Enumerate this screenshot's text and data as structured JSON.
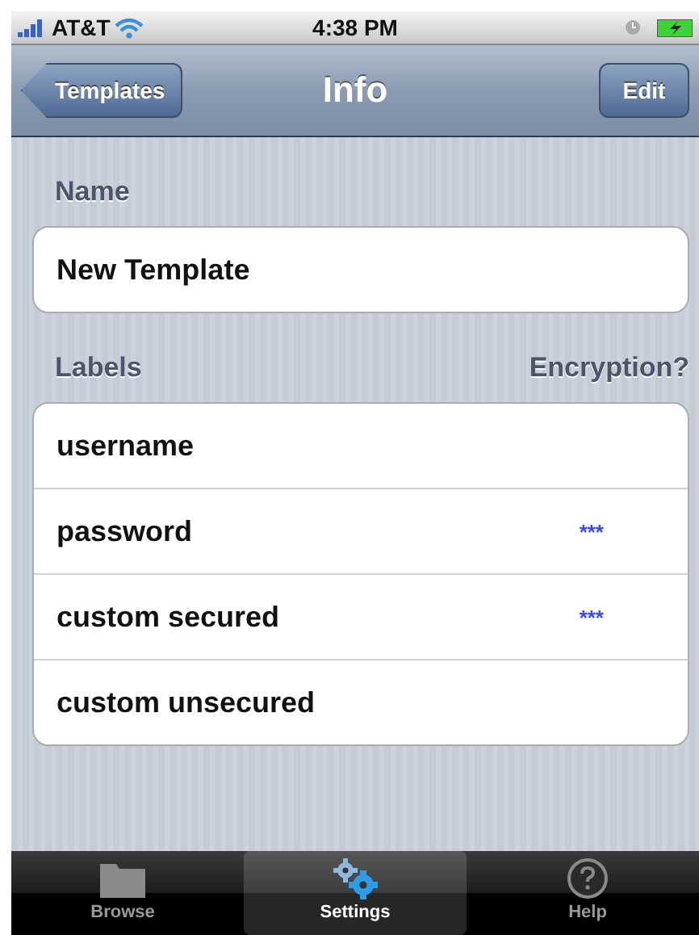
{
  "status_bar": {
    "carrier": "AT&T",
    "time": "4:38 PM"
  },
  "nav_bar": {
    "back": "Templates",
    "title": "Info",
    "action": "Edit"
  },
  "name_section": {
    "header": "Name",
    "value": "New Template"
  },
  "labels_section": {
    "header": "Labels",
    "header_right": "Encryption?",
    "rows": [
      {
        "label": "username"
      },
      {
        "label": "password",
        "mask": "***"
      },
      {
        "label": "custom secured",
        "mask": "***"
      },
      {
        "label": "custom unsecured"
      }
    ]
  },
  "tab_bar": [
    {
      "label": "Browse",
      "kind": "folder",
      "selected": false
    },
    {
      "label": "Settings",
      "kind": "gears",
      "selected": true
    },
    {
      "label": "Help",
      "kind": "help",
      "selected": false
    }
  ]
}
